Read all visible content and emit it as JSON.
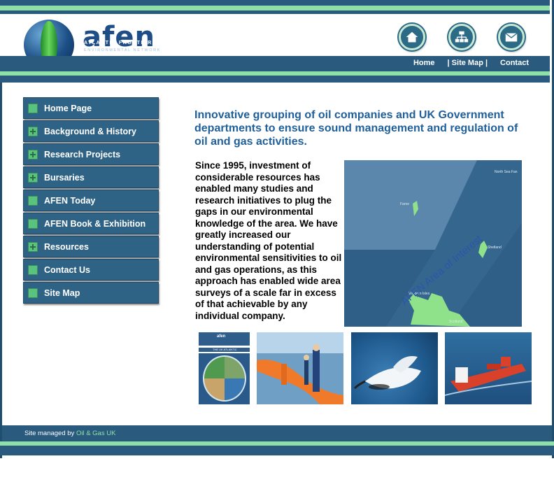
{
  "header": {
    "logo_word": "afen",
    "logo_line1": "ATLANTIC FRONTIER",
    "logo_line2": "ENVIRONMENTAL NETWORK",
    "icons": [
      "home-icon",
      "site-map-icon",
      "contact-envelope-icon"
    ],
    "nav_links": [
      {
        "label": "Home"
      },
      {
        "label": "| Site Map |"
      },
      {
        "label": "Contact"
      }
    ]
  },
  "sidebar": {
    "items": [
      {
        "label": "Home Page",
        "expandable": false
      },
      {
        "label": "Background & History",
        "expandable": true
      },
      {
        "label": "Research Projects",
        "expandable": true
      },
      {
        "label": "Bursaries",
        "expandable": true
      },
      {
        "label": "AFEN Today",
        "expandable": false
      },
      {
        "label": "AFEN Book & Exhibition",
        "expandable": false
      },
      {
        "label": "Resources",
        "expandable": true
      },
      {
        "label": "Contact Us",
        "expandable": false
      },
      {
        "label": "Site Map",
        "expandable": false
      }
    ]
  },
  "main": {
    "headline": "Innovative grouping of oil companies and UK Government departments to ensure sound management and regulation of oil and gas activities.",
    "body": "Since 1995, investment of considerable resources has enabled many studies and research initiatives to plug the gaps in our environmental knowledge of the area. We have greatly increased our understanding of potential environmental sensitivities to oil and gas operations, as this approach has enabled wide area surveys of a scale far in excess of that achievable by any individual company.",
    "map": {
      "area_label": "AFEN Area of Interest",
      "labels": [
        "North Sea Fan",
        "Faroe",
        "Shetland",
        "Western Isles",
        "Scotland"
      ]
    },
    "book_cover": {
      "title": "afen",
      "subtitle": "THE UK ATLANTIC"
    }
  },
  "footer": {
    "prefix": "Site managed by ",
    "link": "Oil & Gas UK"
  },
  "colors": {
    "dark_blue": "#2a5a7e",
    "green_stripe": "#8ee0a6",
    "headline_blue": "#1f5f9a"
  }
}
